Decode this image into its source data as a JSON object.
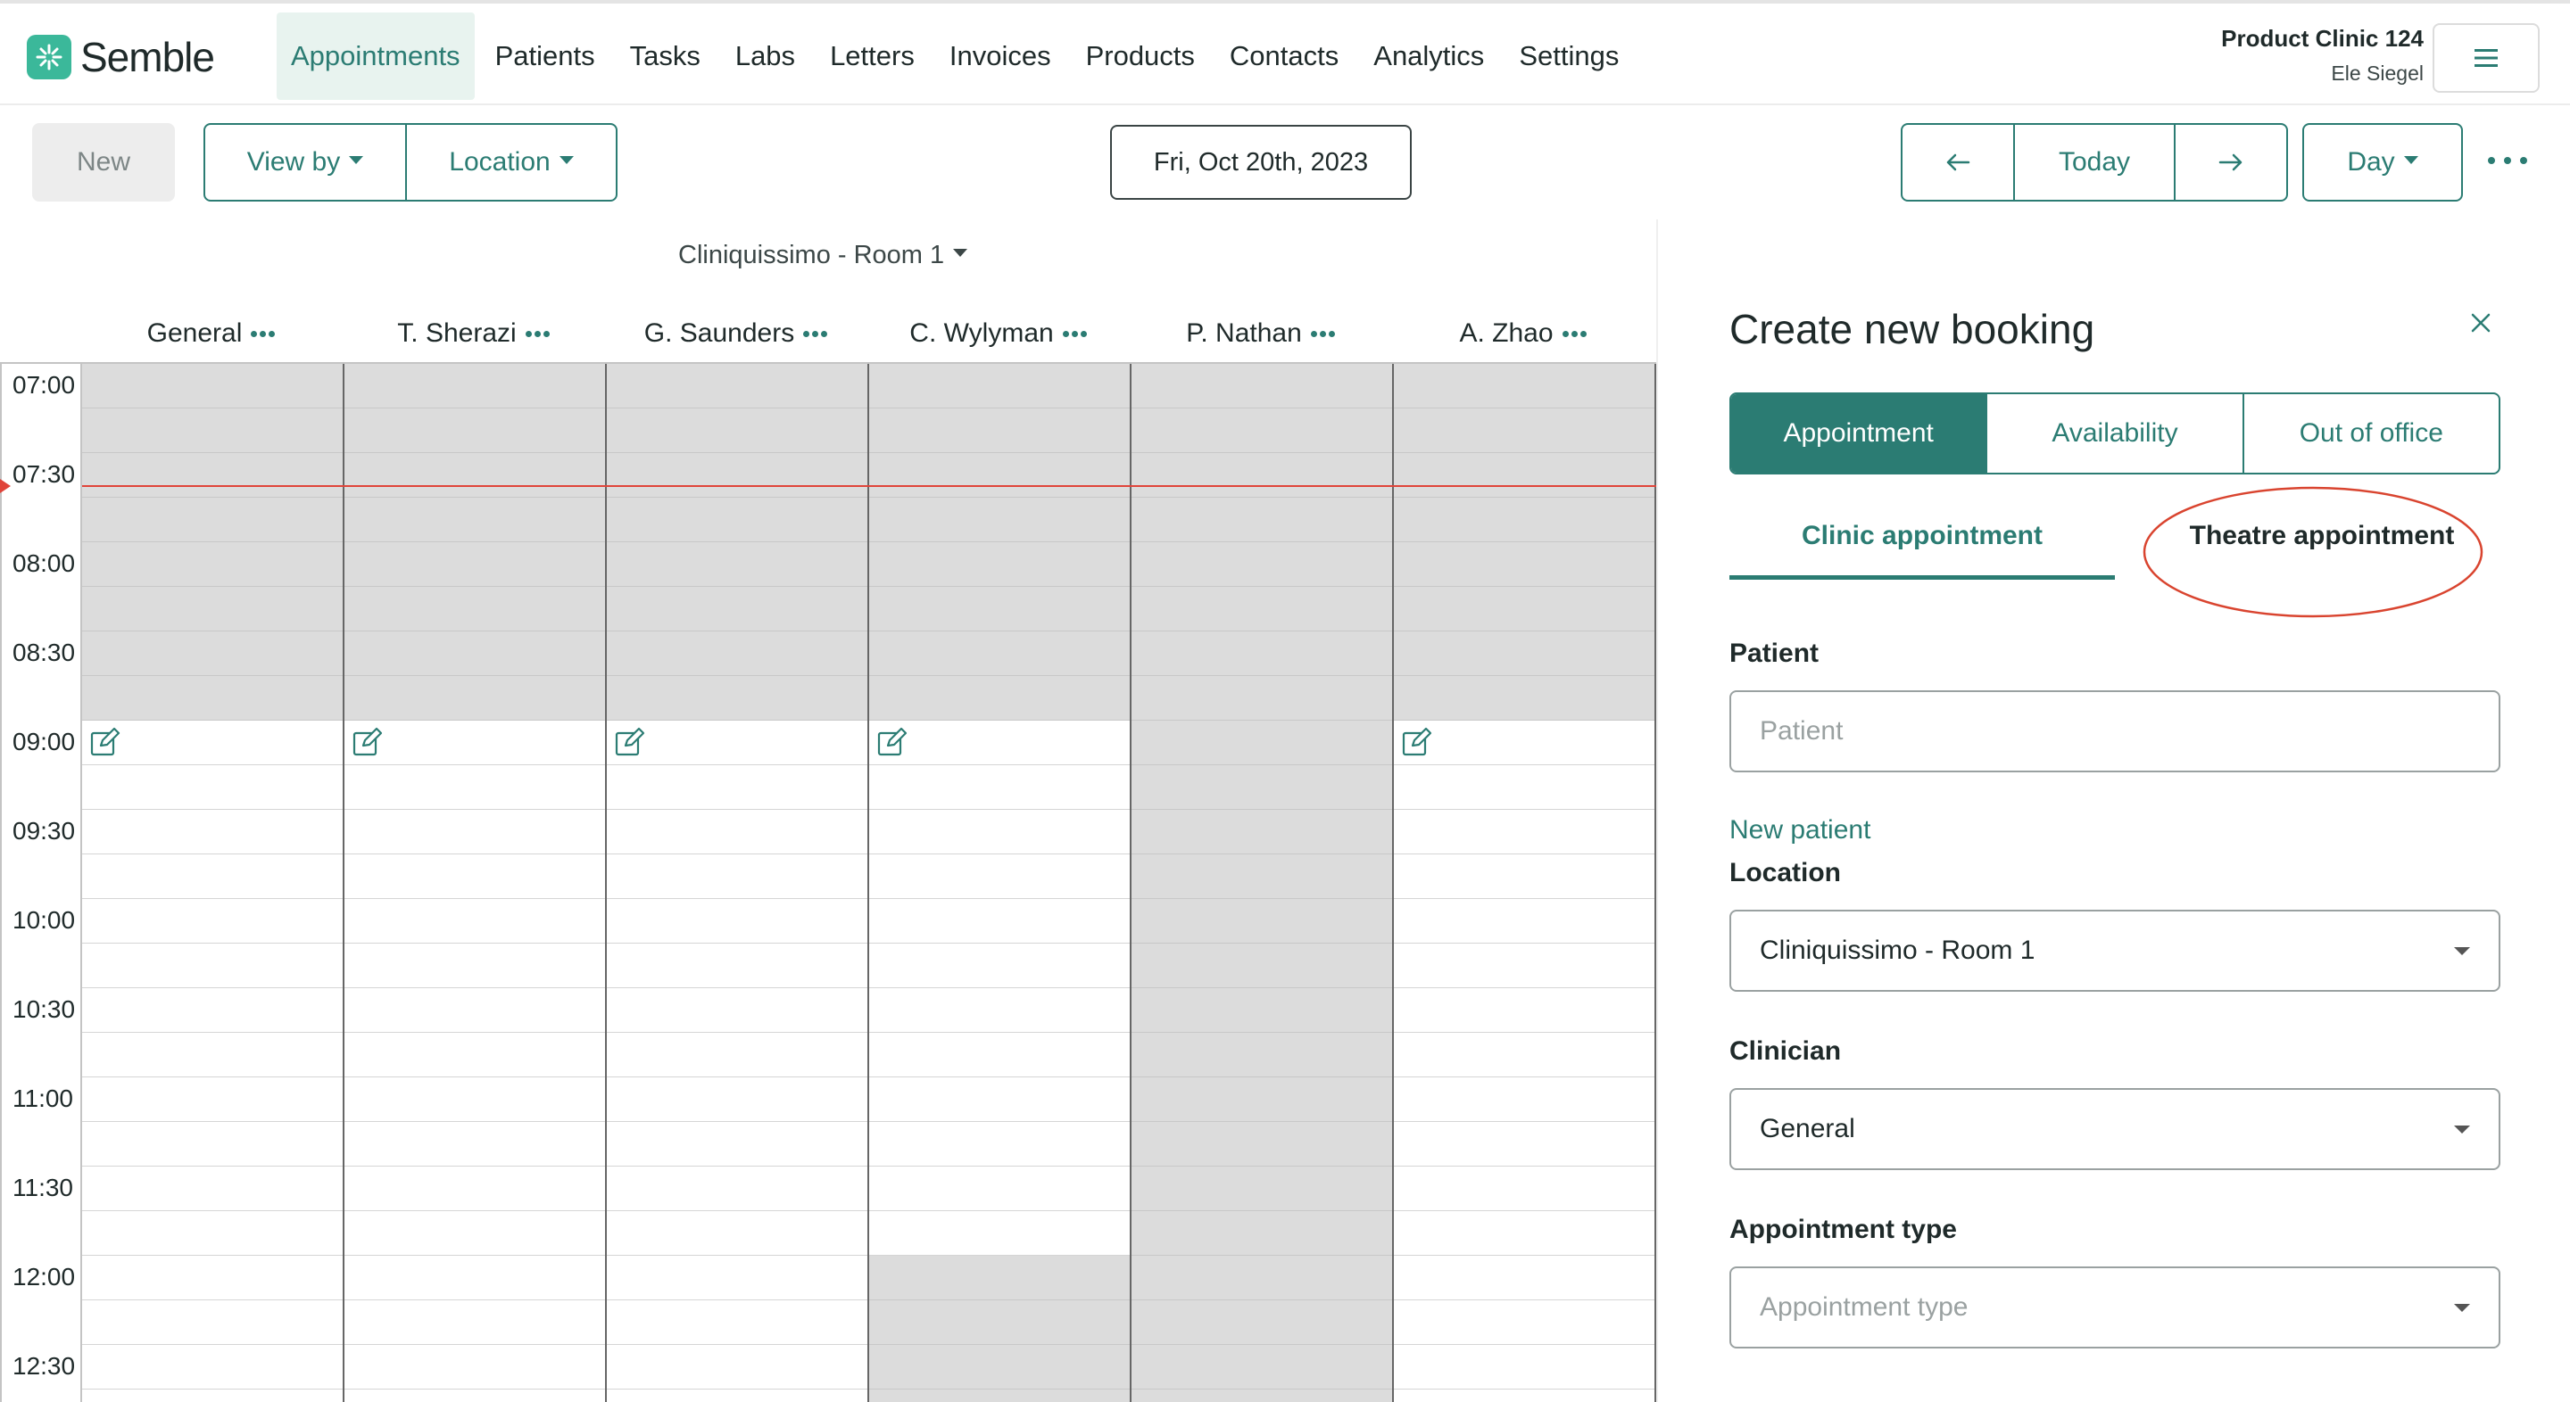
{
  "app": {
    "brand": "Semble",
    "clinic_name": "Product Clinic 124",
    "user_name": "Ele Siegel"
  },
  "nav": {
    "items": [
      "Appointments",
      "Patients",
      "Tasks",
      "Labs",
      "Letters",
      "Invoices",
      "Products",
      "Contacts",
      "Analytics",
      "Settings"
    ],
    "active": "Appointments"
  },
  "toolbar": {
    "new_label": "New",
    "view_by_label": "View by",
    "location_label": "Location",
    "date_label": "Fri, Oct 20th, 2023",
    "prev_icon": "arrow-left-icon",
    "today_label": "Today",
    "next_icon": "arrow-right-icon",
    "day_label": "Day",
    "more_icon": "more-horizontal-icon"
  },
  "calendar": {
    "room": "Cliniquissimo - Room 1",
    "columns": [
      {
        "name": "General"
      },
      {
        "name": "T. Sherazi"
      },
      {
        "name": "G. Saunders"
      },
      {
        "name": "C. Wylyman"
      },
      {
        "name": "P. Nathan"
      },
      {
        "name": "A. Zhao"
      }
    ],
    "times": [
      "07:00",
      "07:30",
      "08:00",
      "08:30",
      "09:00",
      "09:30",
      "10:00",
      "10:30",
      "11:00",
      "11:30",
      "12:00",
      "12:30"
    ],
    "current_time": "07:37",
    "colors": {
      "unavailable": "#dcdcdc",
      "now_line": "#e0443a",
      "accent": "#2b7c73"
    }
  },
  "booking": {
    "title": "Create new booking",
    "close_icon": "close-icon",
    "tabs": [
      "Appointment",
      "Availability",
      "Out of office"
    ],
    "active_tab": "Appointment",
    "subtabs": [
      "Clinic appointment",
      "Theatre appointment"
    ],
    "active_subtab": "Clinic appointment",
    "patient_label": "Patient",
    "patient_placeholder": "Patient",
    "new_patient_link": "New patient",
    "location_label": "Location",
    "location_value": "Cliniquissimo - Room 1",
    "clinician_label": "Clinician",
    "clinician_value": "General",
    "appointment_type_label": "Appointment type",
    "appointment_type_placeholder": "Appointment type"
  }
}
